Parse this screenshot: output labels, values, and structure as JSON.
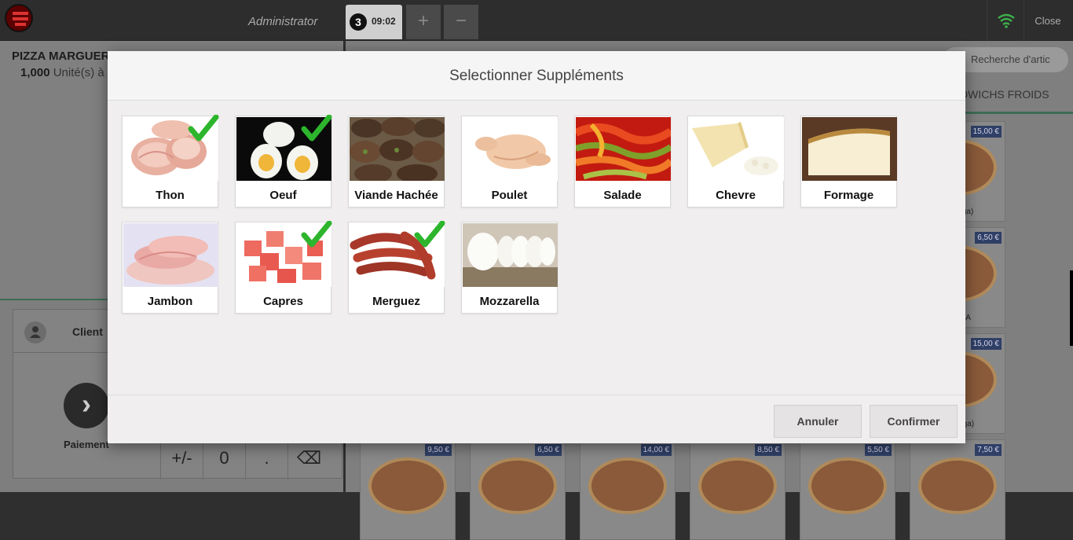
{
  "topbar": {
    "user": "Administrator",
    "order_number": "3",
    "order_time": "09:02",
    "add_symbol": "+",
    "remove_symbol": "−",
    "close_label": "Close"
  },
  "order": {
    "product_name": "PIZZA MARGUERI",
    "qty_value": "1,000",
    "qty_unit": "Unité(s) à"
  },
  "client": {
    "label": "Client",
    "payment_label": "Paiement"
  },
  "numpad": [
    "+/-",
    "0",
    ".",
    "⌫"
  ],
  "products": {
    "search_placeholder": "Recherche d'artic",
    "category_label": "DWICHS FROIDS",
    "right_cards": [
      {
        "price": "15,00 €",
        "name": "A (Mega)"
      },
      {
        "price": "6,50 €",
        "name": "NZANA"
      },
      {
        "price": "15,00 €",
        "name": "O (Mega)"
      }
    ],
    "bottom_prices": [
      "9,50 €",
      "6,50 €",
      "14,00 €",
      "8,50 €",
      "5,50 €",
      "7,50 €"
    ]
  },
  "modal": {
    "title": "Selectionner Suppléments",
    "cancel_label": "Annuler",
    "confirm_label": "Confirmer",
    "items": [
      {
        "label": "Thon",
        "selected": true,
        "image": "tuna"
      },
      {
        "label": "Oeuf",
        "selected": true,
        "image": "egg"
      },
      {
        "label": "Viande Hachée",
        "selected": false,
        "image": "minced-meat"
      },
      {
        "label": "Poulet",
        "selected": false,
        "image": "chicken"
      },
      {
        "label": "Salade",
        "selected": false,
        "image": "peppers"
      },
      {
        "label": "Chevre",
        "selected": false,
        "image": "goat-cheese"
      },
      {
        "label": "Formage",
        "selected": false,
        "image": "cheese-wedge"
      },
      {
        "label": "Jambon",
        "selected": false,
        "image": "ham"
      },
      {
        "label": "Capres",
        "selected": true,
        "image": "tomato-cubes"
      },
      {
        "label": "Merguez",
        "selected": true,
        "image": "sausages"
      },
      {
        "label": "Mozzarella",
        "selected": false,
        "image": "mozzarella"
      }
    ]
  },
  "colors": {
    "check_green": "#2db52d",
    "modal_bg": "#f0eeee",
    "topbar_bg": "#2d2d2d",
    "accent_green": "#3e6c55",
    "wifi_green": "#3cb04a"
  }
}
